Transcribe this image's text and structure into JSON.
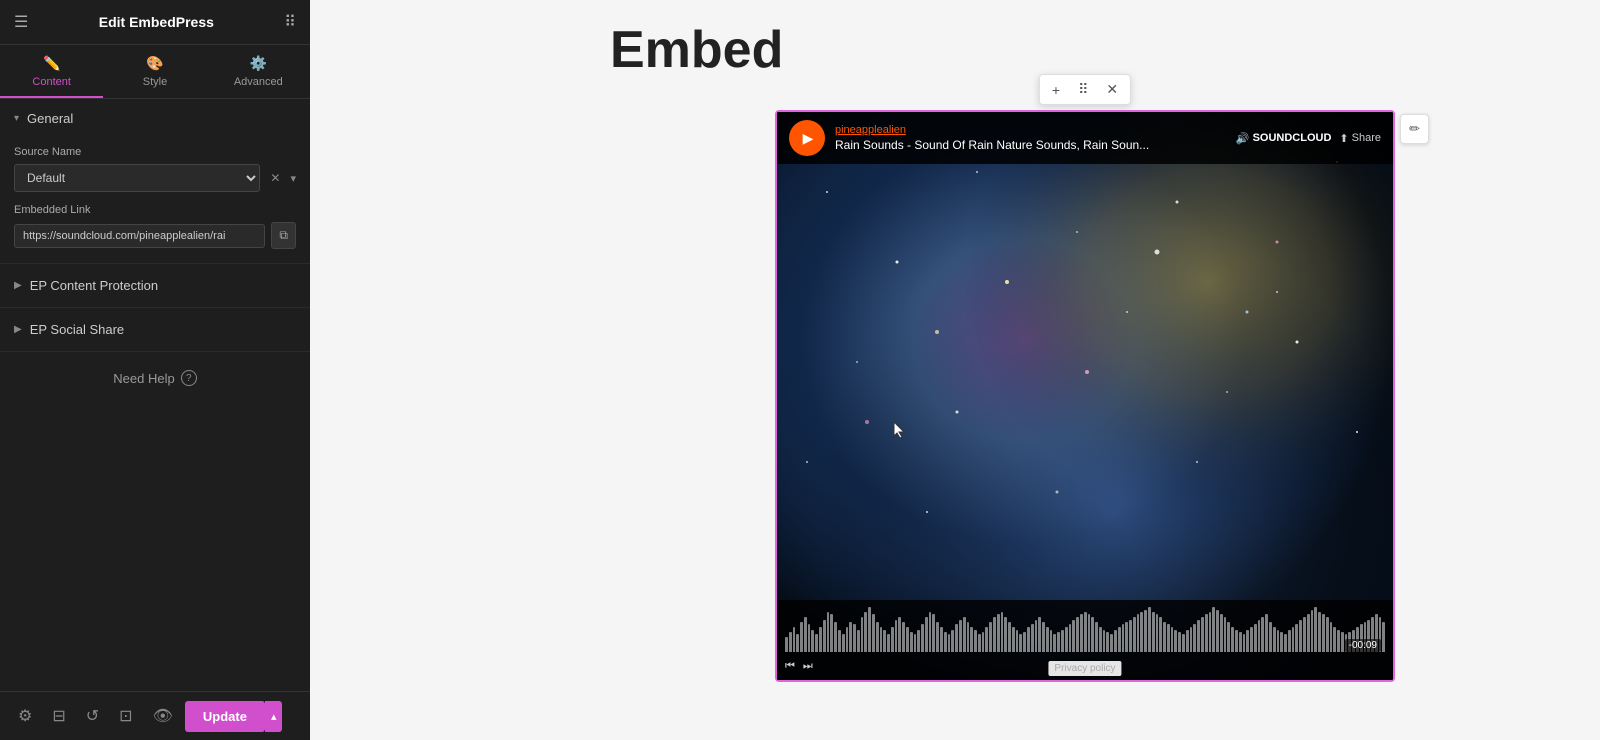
{
  "sidebar": {
    "title": "Edit EmbedPress",
    "tabs": [
      {
        "id": "content",
        "label": "Content",
        "icon": "✏️",
        "active": true
      },
      {
        "id": "style",
        "label": "Style",
        "icon": "🎨",
        "active": false
      },
      {
        "id": "advanced",
        "label": "Advanced",
        "icon": "⚙️",
        "active": false
      }
    ],
    "sections": {
      "general": {
        "label": "General",
        "expanded": true,
        "source_name_label": "Source Name",
        "source_name_value": "Default",
        "embedded_link_label": "Embedded Link",
        "embedded_link_value": "https://soundcloud.com/pineapplealien/rai"
      },
      "content_protection": {
        "label": "EP Content Protection",
        "expanded": false
      },
      "social_share": {
        "label": "EP Social Share",
        "expanded": false
      }
    },
    "need_help": "Need Help",
    "footer": {
      "update_label": "Update"
    }
  },
  "main": {
    "page_title": "Embed",
    "widget_toolbar": {
      "add": "+",
      "move": "⠿",
      "close": "✕"
    },
    "soundcloud": {
      "artist": "pineapplealien",
      "track_title": "Rain Sounds - Sound Of Rain Nature Sounds, Rain Soun...",
      "sc_logo": "🔊 SOUNDCLOUD",
      "share_label": "Share",
      "time_display": "-00:09",
      "privacy_policy": "Privacy policy"
    }
  },
  "icons": {
    "hamburger": "☰",
    "grid": "⠿",
    "chevron_down": "▾",
    "chevron_right": "▶",
    "pencil": "✏",
    "copy": "⧉",
    "settings": "⚙",
    "layers": "⊟",
    "history": "↺",
    "responsive": "⊡",
    "eye": "👁",
    "chevron_up": "▴",
    "play": "▶"
  }
}
